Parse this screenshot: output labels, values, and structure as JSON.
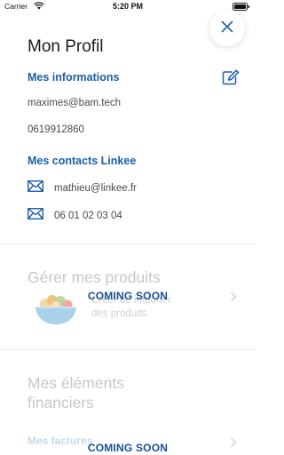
{
  "status": {
    "carrier": "Carrier",
    "time": "5:20 PM"
  },
  "profile": {
    "title": "Mon Profil",
    "info_header": "Mes informations",
    "email": "maximes@bam.tech",
    "phone": "0619912860",
    "contacts_header": "Mes contacts Linkee",
    "contact_email": "mathieu@linkee.fr",
    "contact_phone": "06 01 02 03 04"
  },
  "products": {
    "title": "Gérer mes produits",
    "subtitle": "Créer ou importer des produits",
    "coming_soon": "COMING SOON"
  },
  "finance": {
    "title": "Mes éléments financiers",
    "invoices_label": "Mes factures",
    "coming_soon": "COMING SOON"
  },
  "colors": {
    "accent": "#1a5fa8",
    "coming_soon": "#1a4e93",
    "faded": "#c8c8c8"
  }
}
